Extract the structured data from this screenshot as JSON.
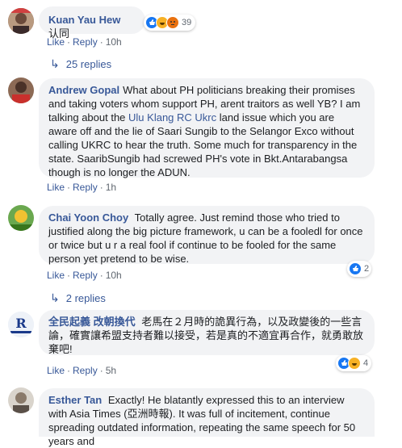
{
  "comments": [
    {
      "name": "Kuan Yau Hew",
      "text": "认同",
      "actions": {
        "like": "Like",
        "reply": "Reply",
        "time": "10h"
      },
      "reactions": {
        "count": "39",
        "icons": [
          "like-icon",
          "haha-icon",
          "angry-icon"
        ]
      },
      "replies": "25 replies"
    },
    {
      "name": "Andrew Gopal",
      "text_before": "What about PH politicians breaking their promises and taking voters whom support PH, arent traitors as well YB? I am talking about the ",
      "link": "Ulu Klang RC Ukrc",
      "text_after": " land issue which you are aware off and the lie of Saari Sungib to the Selangor Exco without calling UKRC to hear the truth. Some much for transparency in the state. SaaribSungib had screwed PH's vote in Bkt.Antarabangsa though is no longer the ADUN.",
      "actions": {
        "like": "Like",
        "reply": "Reply",
        "time": "1h"
      }
    },
    {
      "name": "Chai Yoon Choy",
      "text": "Totally agree. Just remind those who tried to justified along the big picture framework, u can be a fooledl for once or twice but u r a real fool if continue to be fooled for the same person yet pretend to be wise.",
      "actions": {
        "like": "Like",
        "reply": "Reply",
        "time": "10h"
      },
      "reactions": {
        "count": "2",
        "icons": [
          "like-icon"
        ]
      },
      "replies": "2 replies"
    },
    {
      "name": "全民起義 改朝換代",
      "text": "老馬在２月時的詭異行為，以及政變後的一些言論，確實讓希盟支持者難以接受，若是真的不適宜再合作，就勇敢放棄吧!",
      "actions": {
        "like": "Like",
        "reply": "Reply",
        "time": "5h"
      },
      "reactions": {
        "count": "4",
        "icons": [
          "like-icon",
          "haha-icon"
        ]
      }
    },
    {
      "name": "Esther Tan",
      "text": "Exactly! He blatantly expressed this to an interview with Asia Times (亞洲時報). It was full of incitement, continue spreading outdated information, repeating the same speech for 50 years and"
    }
  ]
}
